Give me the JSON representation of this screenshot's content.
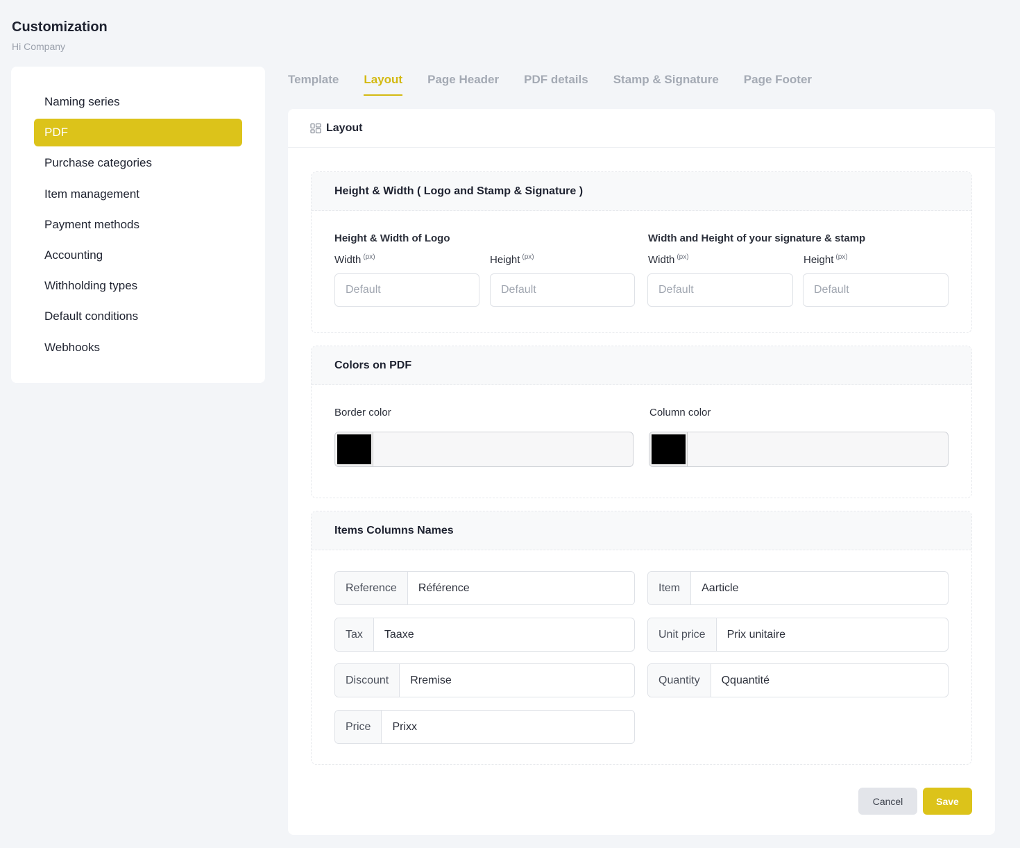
{
  "page": {
    "title": "Customization",
    "subtitle": "Hi Company"
  },
  "sidebar": {
    "items": [
      {
        "label": "Naming series"
      },
      {
        "label": "PDF"
      },
      {
        "label": "Purchase categories"
      },
      {
        "label": "Item management"
      },
      {
        "label": "Payment methods"
      },
      {
        "label": "Accounting"
      },
      {
        "label": "Withholding types"
      },
      {
        "label": "Default conditions"
      },
      {
        "label": "Webhooks"
      }
    ],
    "active": "PDF"
  },
  "tabs": [
    {
      "label": "Template"
    },
    {
      "label": "Layout"
    },
    {
      "label": "Page Header"
    },
    {
      "label": "PDF details"
    },
    {
      "label": "Stamp & Signature"
    },
    {
      "label": "Page Footer"
    }
  ],
  "active_tab": "Layout",
  "card": {
    "title": "Layout",
    "icon": "layout-icon",
    "dimensions": {
      "title": "Height & Width ( Logo and Stamp & Signature )",
      "logo_group": "Height & Width of Logo",
      "stamp_group": "Width and Height of your signature & stamp",
      "width_label": "Width",
      "height_label": "Height",
      "unit": "(px)",
      "placeholder": "Default"
    },
    "colors": {
      "title": "Colors on PDF",
      "border_label": "Border color",
      "border_value": "#000000",
      "column_label": "Column color",
      "column_value": "#000000"
    },
    "columns": {
      "title": "Items Columns Names",
      "fields": [
        {
          "label": "Reference",
          "value": "Référence"
        },
        {
          "label": "Item",
          "value": "Aarticle"
        },
        {
          "label": "Tax",
          "value": "Taaxe"
        },
        {
          "label": "Unit price",
          "value": "Prix unitaire"
        },
        {
          "label": "Discount",
          "value": "Rremise"
        },
        {
          "label": "Quantity",
          "value": "Qquantité"
        },
        {
          "label": "Price",
          "value": "Prixx"
        }
      ]
    },
    "buttons": {
      "cancel": "Cancel",
      "save": "Save"
    }
  },
  "colors": {
    "accent": "#dcc31a",
    "tab_active": "#d3b912"
  }
}
